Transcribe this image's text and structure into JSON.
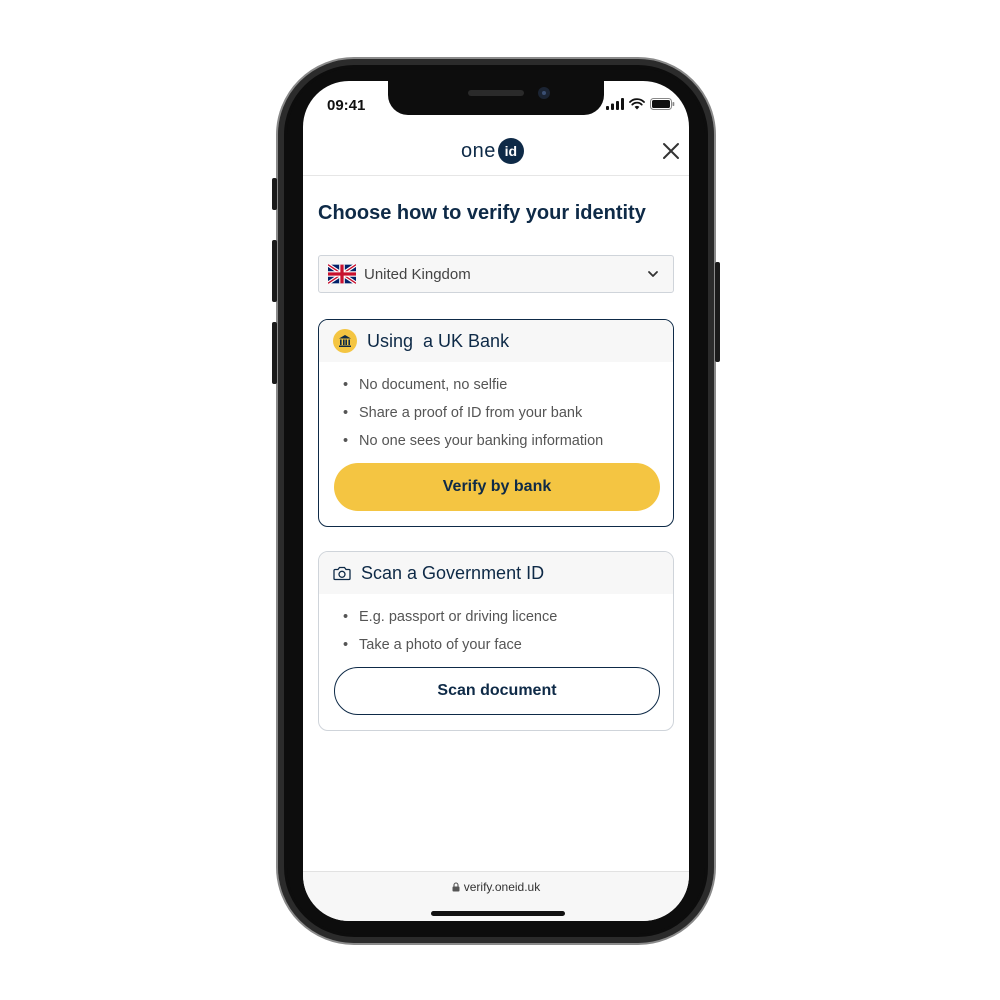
{
  "status_bar": {
    "time": "09:41"
  },
  "header": {
    "logo_text": "one",
    "logo_badge": "id",
    "close_icon": "close-icon"
  },
  "main": {
    "title": "Choose how to verify your identity",
    "country_select": {
      "value": "United Kingdom",
      "flag_icon": "uk-flag-icon"
    },
    "bank_card": {
      "icon": "bank-icon",
      "title": "Using  a UK Bank",
      "bullets": [
        "No document, no selfie",
        "Share a proof of ID from your bank",
        "No one sees your banking information"
      ],
      "button_label": "Verify by bank"
    },
    "gov_card": {
      "icon": "camera-icon",
      "title": "Scan a Government ID",
      "bullets": [
        "E.g. passport or driving licence",
        "Take a photo of your face"
      ],
      "button_label": "Scan document"
    }
  },
  "browser": {
    "url": "verify.oneid.uk",
    "lock_icon": "lock-icon"
  },
  "colors": {
    "navy": "#0e2a47",
    "accent_yellow": "#f4c542"
  }
}
